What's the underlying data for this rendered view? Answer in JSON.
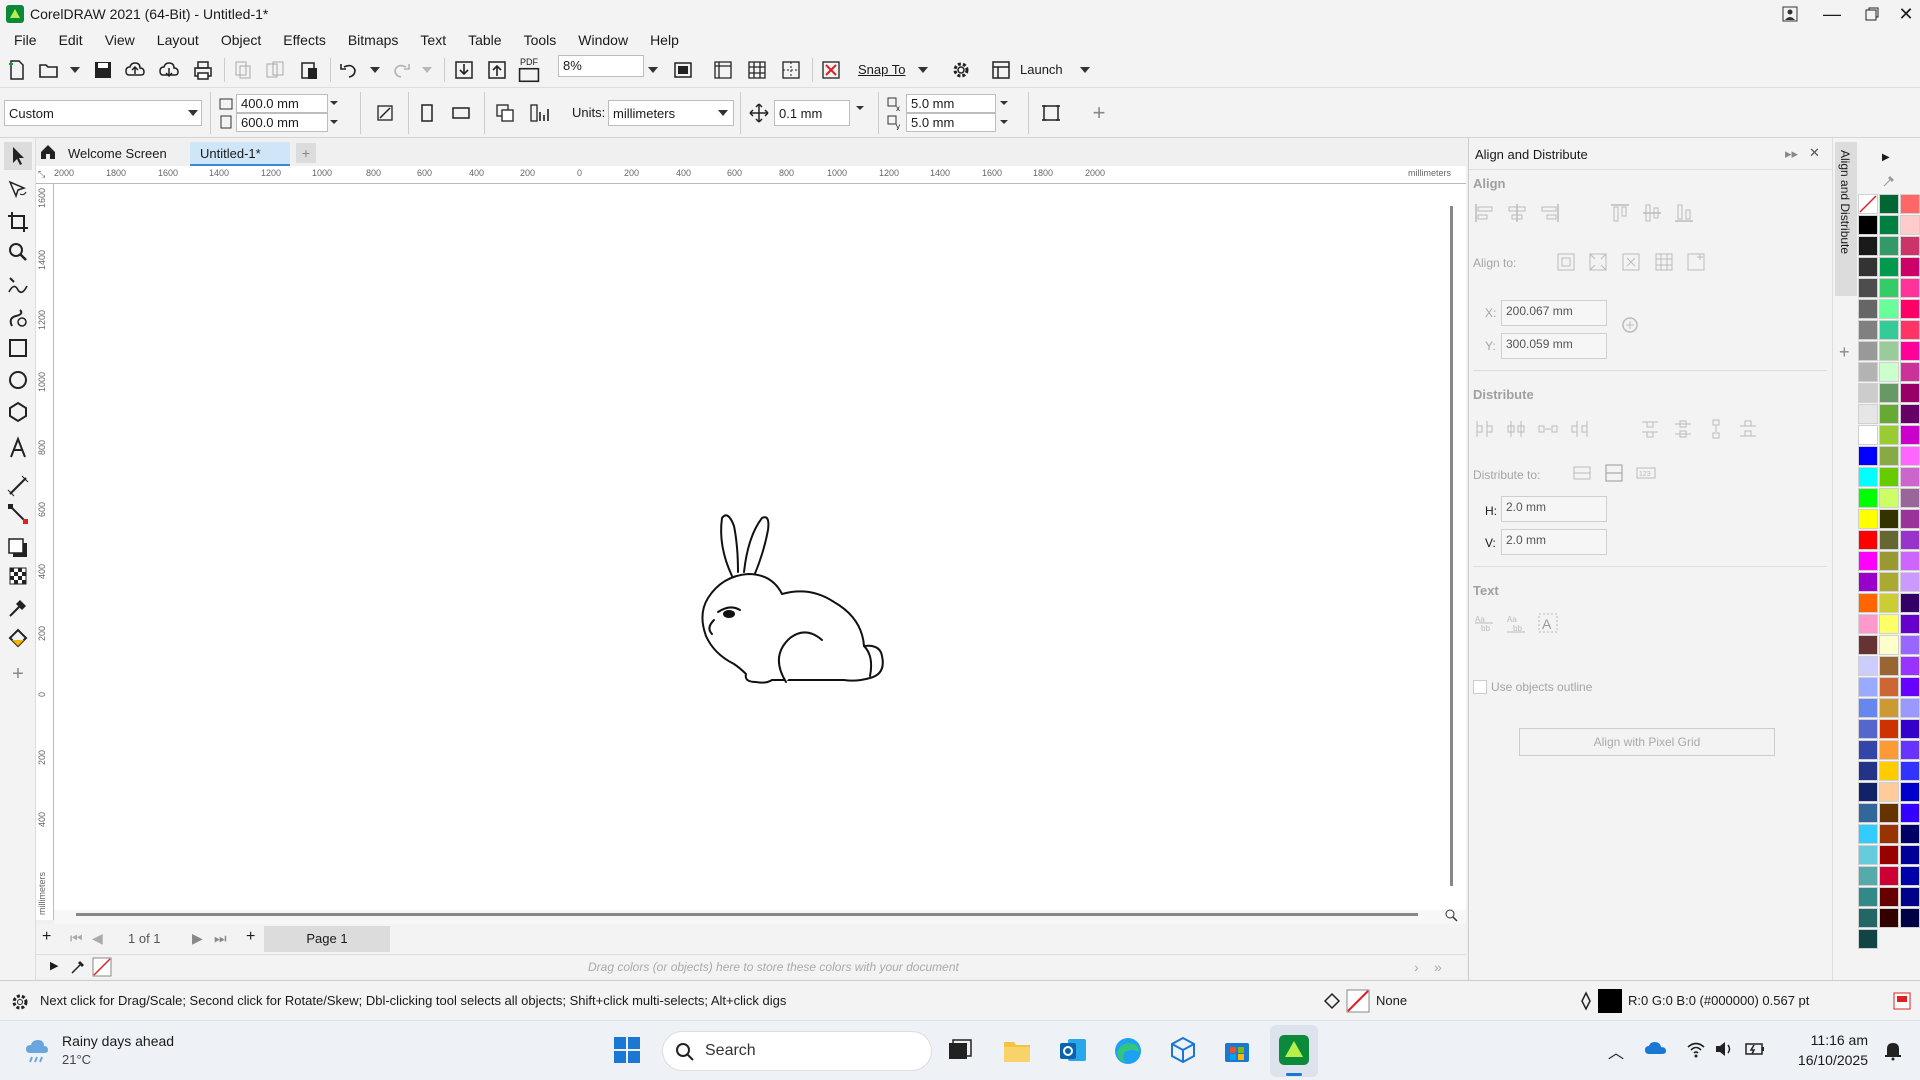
{
  "window": {
    "title": "CorelDRAW 2021 (64-Bit) - Untitled-1*"
  },
  "menu": [
    "File",
    "Edit",
    "View",
    "Layout",
    "Object",
    "Effects",
    "Bitmaps",
    "Text",
    "Table",
    "Tools",
    "Window",
    "Help"
  ],
  "toolbar": {
    "zoom": "8%",
    "snap_label": "Snap To",
    "launch_label": "Launch",
    "pdf_label": "PDF"
  },
  "propbar": {
    "page_preset": "Custom",
    "width": "400.0 mm",
    "height": "600.0 mm",
    "units_label": "Units:",
    "units_value": "millimeters",
    "nudge": "0.1 mm",
    "dup_x": "5.0 mm",
    "dup_y": "5.0 mm"
  },
  "doc_tabs": {
    "welcome": "Welcome Screen",
    "doc": "Untitled-1*"
  },
  "ruler": {
    "h_ticks": [
      "2000",
      "1800",
      "1600",
      "1400",
      "1200",
      "1000",
      "800",
      "600",
      "400",
      "200",
      "0",
      "200",
      "400",
      "600",
      "800",
      "1000",
      "1200",
      "1400",
      "1600",
      "1800",
      "2000"
    ],
    "unit": "millimeters",
    "v_ticks": [
      "1600",
      "1400",
      "1200",
      "1000",
      "800",
      "600",
      "400",
      "200",
      "0",
      "200",
      "400"
    ]
  },
  "pagebar": {
    "page_count": "1 of 1",
    "page_tab": "Page 1"
  },
  "colordrop": {
    "hint": "Drag colors (or objects) here to store these colors with your document"
  },
  "panel": {
    "title": "Align and Distribute",
    "align_header": "Align",
    "align_to_label": "Align to:",
    "x_label": "X:",
    "x_value": "200.067 mm",
    "y_label": "Y:",
    "y_value": "300.059 mm",
    "distribute_header": "Distribute",
    "distribute_to_label": "Distribute to:",
    "h_label": "H:",
    "h_value": "2.0 mm",
    "v_label": "V:",
    "v_value": "2.0 mm",
    "text_header": "Text",
    "use_outline_label": "Use objects outline",
    "pixel_grid_button": "Align with Pixel Grid",
    "dock_tab_label": "Align and Distribute"
  },
  "status": {
    "hint": "Next click for Drag/Scale; Second click for Rotate/Skew; Dbl-clicking tool selects all objects; Shift+click multi-selects; Alt+click digs",
    "fill_label": "None",
    "outline_info": "R:0 G:0 B:0 (#000000)  0.567 pt"
  },
  "taskbar": {
    "weather_title": "Rainy days ahead",
    "weather_temp": "21°C",
    "search_label": "Search",
    "time": "11:16 am",
    "date": "16/10/2025"
  },
  "palette_col1": [
    "#000000",
    "#1a1a1a",
    "#333333",
    "#4d4d4d",
    "#666666",
    "#808080",
    "#999999",
    "#b3b3b3",
    "#cccccc",
    "#e6e6e6",
    "#ffffff",
    "#0000ff",
    "#00ffff",
    "#00ff00",
    "#ffff00",
    "#ff0000",
    "#ff00ff",
    "#9900cc",
    "#ff6600",
    "#ff99cc",
    "#663333",
    "#ccccff",
    "#99aaff",
    "#6688ee",
    "#5566cc",
    "#3344aa",
    "#223388",
    "#112266",
    "#336699",
    "#33ccff",
    "#66ccdd",
    "#55aaaa",
    "#338888",
    "#226666",
    "#114444"
  ],
  "palette_col2": [
    "#006633",
    "#008040",
    "#339966",
    "#00994d",
    "#33cc66",
    "#66ff99",
    "#33cc99",
    "#99cc99",
    "#ccffcc",
    "#669966",
    "#66aa33",
    "#99cc33",
    "#88aa44",
    "#66cc00",
    "#ccff66",
    "#333300",
    "#666633",
    "#999933",
    "#aaaa33",
    "#cccc33",
    "#ffff66",
    "#ffffcc",
    "#996633",
    "#cc6633",
    "#cc9933",
    "#cc3300",
    "#ff9933",
    "#ffcc00",
    "#ffcc99",
    "#663300",
    "#993300",
    "#990000",
    "#cc0033",
    "#660000",
    "#330000"
  ],
  "palette_col3": [
    "#ff6666",
    "#ffcccc",
    "#cc3366",
    "#cc0066",
    "#ff3399",
    "#ff0066",
    "#ff3366",
    "#ff0099",
    "#cc3399",
    "#990066",
    "#660066",
    "#cc00cc",
    "#ff66ff",
    "#cc66cc",
    "#996699",
    "#993399",
    "#9933cc",
    "#cc66ff",
    "#cc99ff",
    "#330066",
    "#6600cc",
    "#9966ff",
    "#9933ff",
    "#6600ff",
    "#9999ff",
    "#3300cc",
    "#6633ff",
    "#3333ff",
    "#0000cc",
    "#3300ff",
    "#000066",
    "#000099",
    "#0000aa",
    "#000088",
    "#000044"
  ]
}
